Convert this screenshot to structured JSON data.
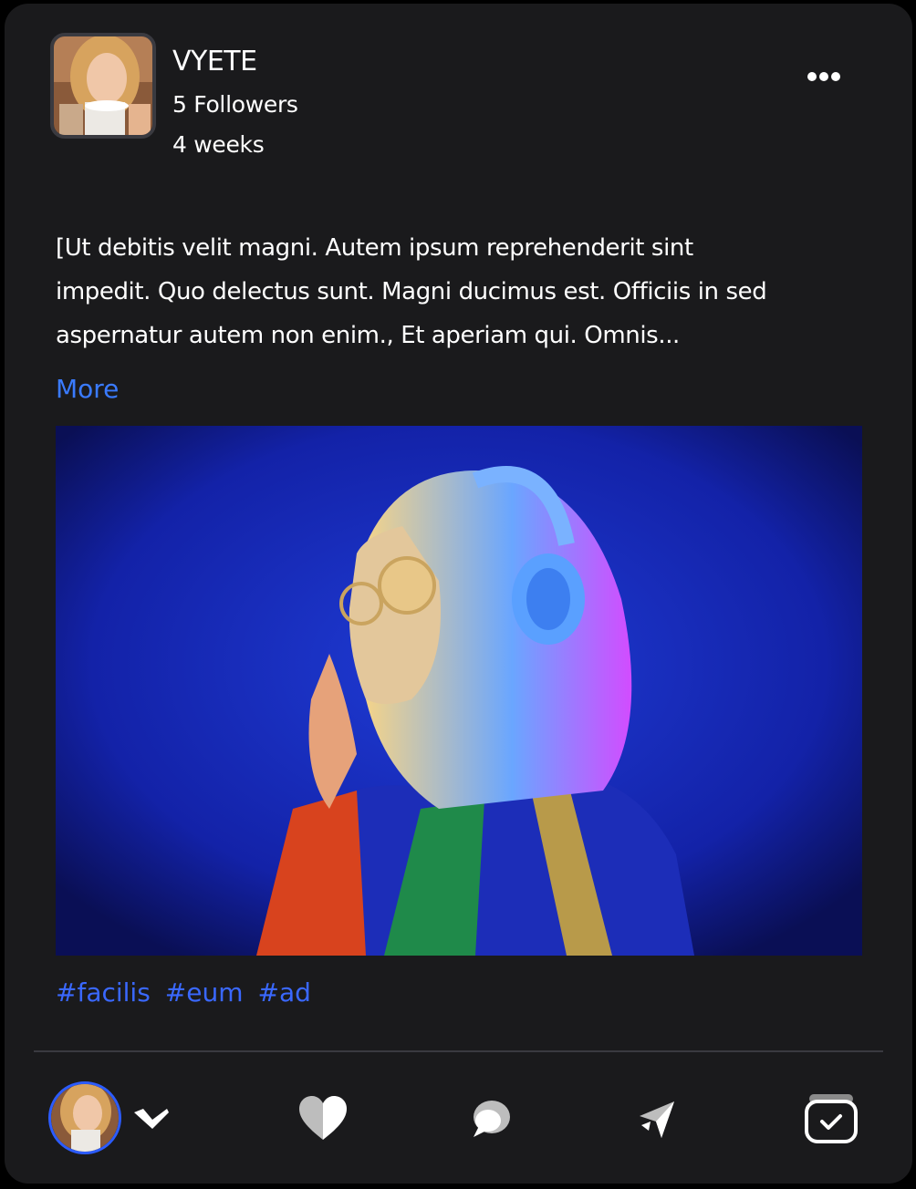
{
  "post": {
    "author": {
      "name": "VYETE",
      "followers": "5 Followers",
      "time_ago": "4 weeks"
    },
    "text_lines": [
      "[Ut debitis velit magni. Autem ipsum reprehenderit sint",
      "impedit. Quo delectus sunt. Magni ducimus est. Officiis in sed",
      "aspernatur autem non enim., Et aperiam qui. Omnis..."
    ],
    "more_label": "More",
    "hashtags": [
      "#facilis",
      "#eum",
      "#ad"
    ]
  },
  "actions": {
    "icons": [
      "reaction-selector-icon",
      "heart-icon",
      "comment-icon",
      "share-icon",
      "save-icon"
    ]
  },
  "colors": {
    "card_bg": "#1a1a1c",
    "accent": "#3a7bff",
    "hashtag": "#3a68ff"
  }
}
